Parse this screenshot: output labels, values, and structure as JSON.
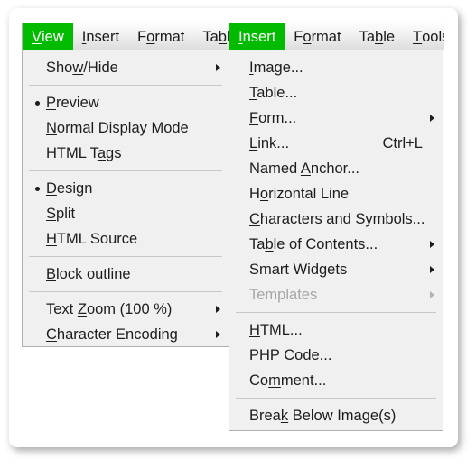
{
  "view_menu": {
    "menubar": [
      {
        "label": "View",
        "mnemonic": "V",
        "active": true
      },
      {
        "label": "Insert",
        "mnemonic": "I",
        "active": false
      },
      {
        "label": "Format",
        "mnemonic": "o",
        "active": false
      },
      {
        "label": "Table",
        "mnemonic": "b",
        "active": false
      }
    ],
    "items": [
      {
        "label": "Show/Hide",
        "mnemonic": "w",
        "submenu": true,
        "bullet": false,
        "disabled": false
      },
      {
        "separator": true
      },
      {
        "label": "Preview",
        "mnemonic": "P",
        "submenu": false,
        "bullet": true,
        "disabled": false
      },
      {
        "label": "Normal Display Mode",
        "mnemonic": "N",
        "submenu": false,
        "bullet": false,
        "disabled": false
      },
      {
        "label": "HTML Tags",
        "mnemonic": "a",
        "submenu": false,
        "bullet": false,
        "disabled": false
      },
      {
        "separator": true
      },
      {
        "label": "Design",
        "mnemonic": "D",
        "submenu": false,
        "bullet": true,
        "disabled": false
      },
      {
        "label": "Split",
        "mnemonic": "S",
        "submenu": false,
        "bullet": false,
        "disabled": false
      },
      {
        "label": "HTML Source",
        "mnemonic": "H",
        "submenu": false,
        "bullet": false,
        "disabled": false
      },
      {
        "separator": true
      },
      {
        "label": "Block outline",
        "mnemonic": "B",
        "submenu": false,
        "bullet": false,
        "disabled": false
      },
      {
        "separator": true
      },
      {
        "label": "Text Zoom (100 %)",
        "mnemonic": "Z",
        "submenu": true,
        "bullet": false,
        "disabled": false
      },
      {
        "label": "Character Encoding",
        "mnemonic": "C",
        "submenu": true,
        "bullet": false,
        "disabled": false
      }
    ]
  },
  "insert_menu": {
    "menubar": [
      {
        "label": "Insert",
        "mnemonic": "I",
        "active": true
      },
      {
        "label": "Format",
        "mnemonic": "o",
        "active": false
      },
      {
        "label": "Table",
        "mnemonic": "b",
        "active": false
      },
      {
        "label": "Tools",
        "mnemonic": "T",
        "active": false
      }
    ],
    "items": [
      {
        "label": "Image...",
        "mnemonic": "I",
        "submenu": false,
        "disabled": false,
        "shortcut": ""
      },
      {
        "label": "Table...",
        "mnemonic": "T",
        "submenu": false,
        "disabled": false,
        "shortcut": ""
      },
      {
        "label": "Form...",
        "mnemonic": "F",
        "submenu": true,
        "disabled": false,
        "shortcut": ""
      },
      {
        "label": "Link...",
        "mnemonic": "L",
        "submenu": false,
        "disabled": false,
        "shortcut": "Ctrl+L"
      },
      {
        "label": "Named Anchor...",
        "mnemonic": "A",
        "submenu": false,
        "disabled": false,
        "shortcut": ""
      },
      {
        "label": "Horizontal Line",
        "mnemonic": "o",
        "submenu": false,
        "disabled": false,
        "shortcut": ""
      },
      {
        "label": "Characters and Symbols...",
        "mnemonic": "C",
        "submenu": false,
        "disabled": false,
        "shortcut": ""
      },
      {
        "label": "Table of Contents...",
        "mnemonic": "b",
        "submenu": true,
        "disabled": false,
        "shortcut": ""
      },
      {
        "label": "Smart Widgets",
        "mnemonic": "",
        "submenu": true,
        "disabled": false,
        "shortcut": ""
      },
      {
        "label": "Templates",
        "mnemonic": "",
        "submenu": true,
        "disabled": true,
        "shortcut": ""
      },
      {
        "separator": true
      },
      {
        "label": "HTML...",
        "mnemonic": "H",
        "submenu": false,
        "disabled": false,
        "shortcut": ""
      },
      {
        "label": "PHP Code...",
        "mnemonic": "P",
        "submenu": false,
        "disabled": false,
        "shortcut": ""
      },
      {
        "label": "Comment...",
        "mnemonic": "m",
        "submenu": false,
        "disabled": false,
        "shortcut": ""
      },
      {
        "separator": true
      },
      {
        "label": "Break Below Image(s)",
        "mnemonic": "k",
        "submenu": false,
        "disabled": false,
        "shortcut": ""
      }
    ]
  },
  "colors": {
    "highlight": "#00bb00",
    "menu_background": "#f0f0f0",
    "text": "#1d1d1d",
    "disabled_text": "#a6a6a6",
    "separator": "#c8c8c8",
    "border": "#b0b0b0"
  }
}
